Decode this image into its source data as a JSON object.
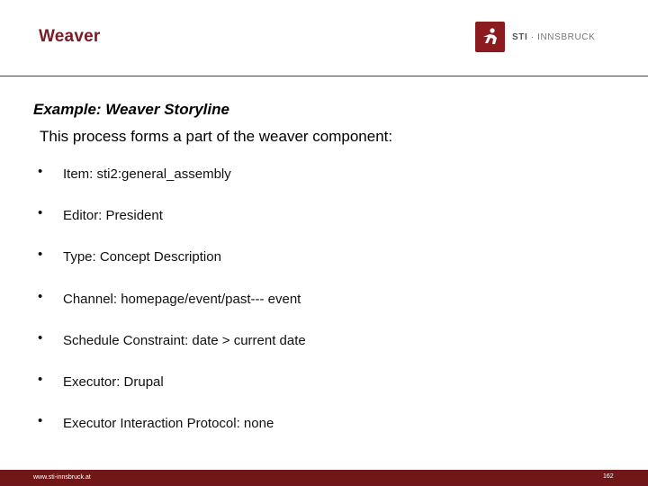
{
  "header": {
    "title": "Weaver",
    "logo": {
      "icon": "sti-runner-icon",
      "brand": "STI",
      "separator": "·",
      "location": "INNSBRUCK",
      "brand_color": "#8b1b1f"
    }
  },
  "content": {
    "subtitle": "Example: Weaver Storyline",
    "intro": "This process forms a part of the weaver component:",
    "bullet_glyph": "•",
    "items": [
      {
        "label": "Item: sti2:general_assembly"
      },
      {
        "label": "Editor: President"
      },
      {
        "label": "Type: Concept Description"
      },
      {
        "label": "Channel: homepage/event/past--- event"
      },
      {
        "label": "Schedule Constraint: date > current date"
      },
      {
        "label": "Executor: Drupal"
      },
      {
        "label": "Executor Interaction Protocol: none"
      }
    ]
  },
  "footer": {
    "url": "www.sti-innsbruck.at",
    "page_number": "162",
    "color": "#721719"
  }
}
